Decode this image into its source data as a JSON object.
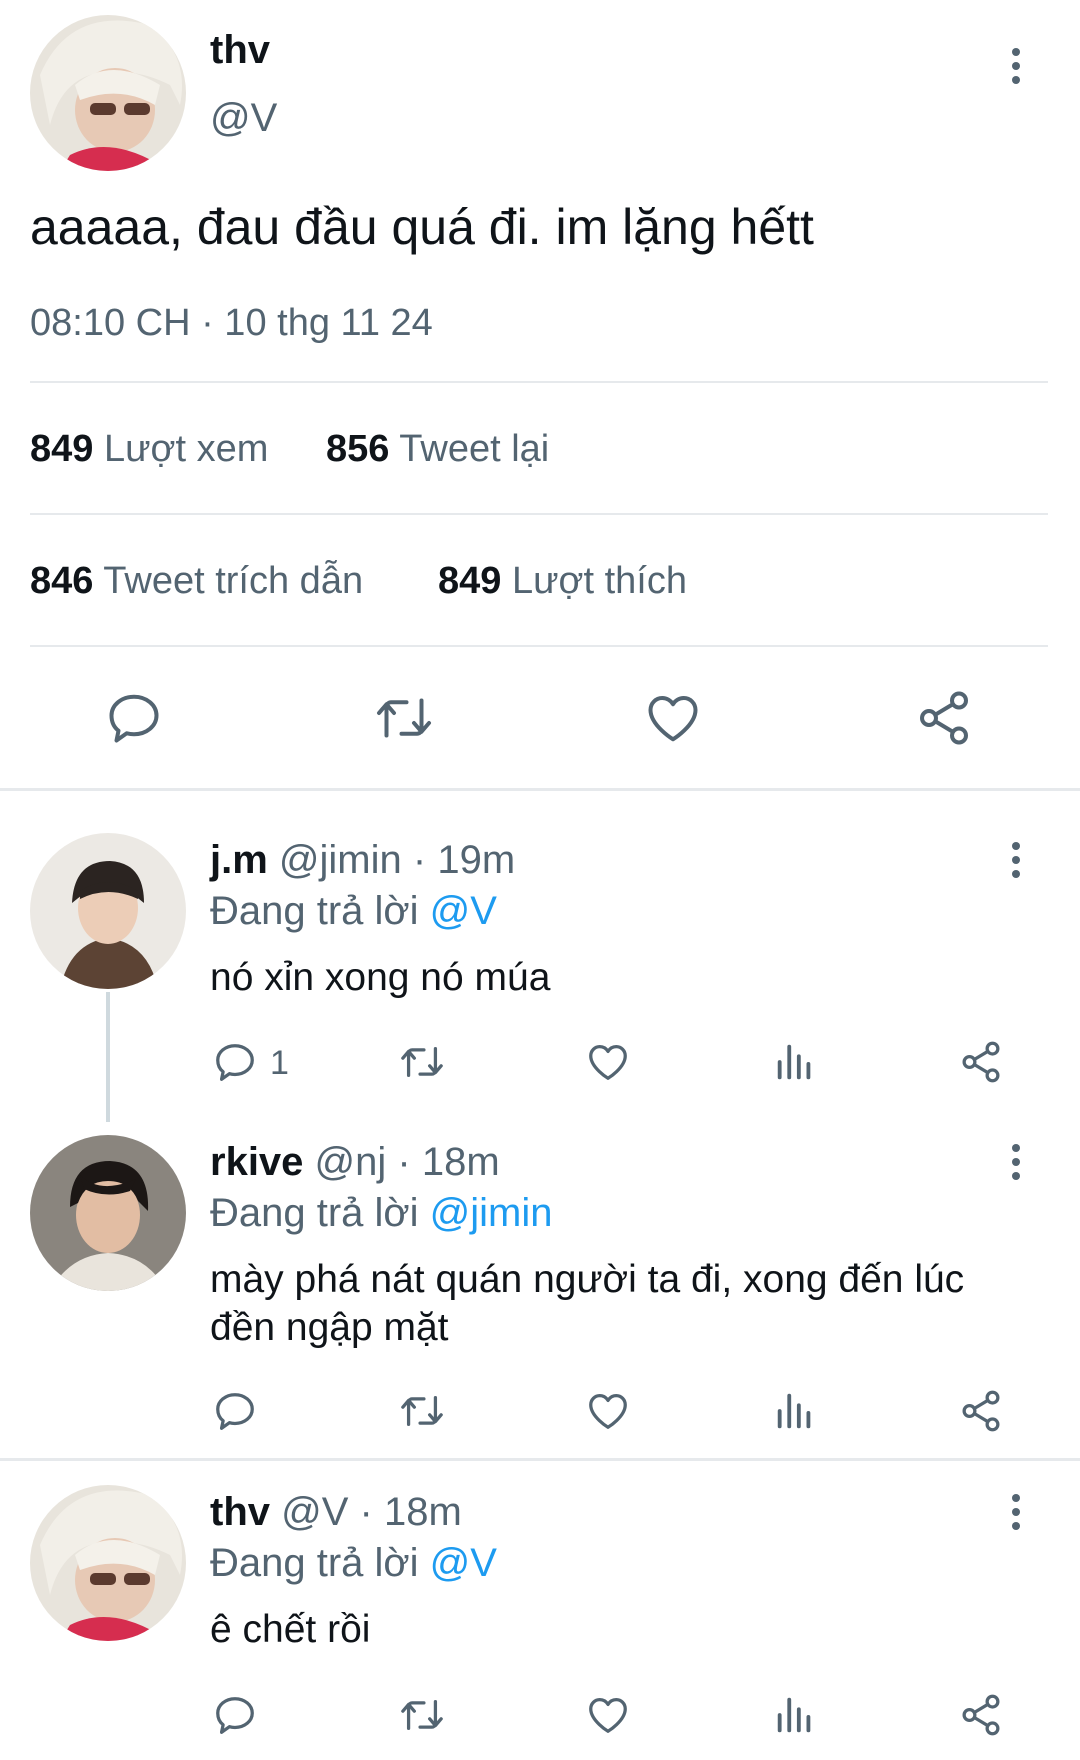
{
  "main_tweet": {
    "display_name": "thv",
    "handle": "@V",
    "text": "aaaaa, đau đầu quá đi. im lặng hếtt",
    "timestamp": "08:10 CH · 10 thg 11 24",
    "stats": {
      "views_count": "849",
      "views_label": "Lượt xem",
      "retweets_count": "856",
      "retweets_label": "Tweet lại",
      "quotes_count": "846",
      "quotes_label": "Tweet trích dẫn",
      "likes_count": "849",
      "likes_label": "Lượt thích"
    }
  },
  "replies": [
    {
      "display_name": "j.m",
      "handle": "@jimin",
      "time": "19m",
      "replying_prefix": "Đang trả lời",
      "replying_to": "@V",
      "text": "nó xỉn xong nó múa",
      "reply_count": "1"
    },
    {
      "display_name": "rkive",
      "handle": "@nj",
      "time": "18m",
      "replying_prefix": "Đang trả lời",
      "replying_to": "@jimin",
      "text": "mày phá nát quán người ta đi, xong đến lúc đền ngập mặt",
      "reply_count": ""
    },
    {
      "display_name": "thv",
      "handle": "@V",
      "time": "18m",
      "replying_prefix": "Đang trả lời",
      "replying_to": "@V",
      "text": "ê chết rồi",
      "reply_count": ""
    }
  ],
  "separator": "·",
  "icons": {
    "reply": "speech-bubble-icon",
    "retweet": "retweet-arrows-icon",
    "like": "heart-icon",
    "share": "share-nodes-icon",
    "analytics": "bar-chart-icon",
    "more": "vertical-ellipsis-icon"
  },
  "colors": {
    "text": "#0f1419",
    "secondary": "#536471",
    "link": "#1d9bf0",
    "divider": "#e6e9ec"
  }
}
